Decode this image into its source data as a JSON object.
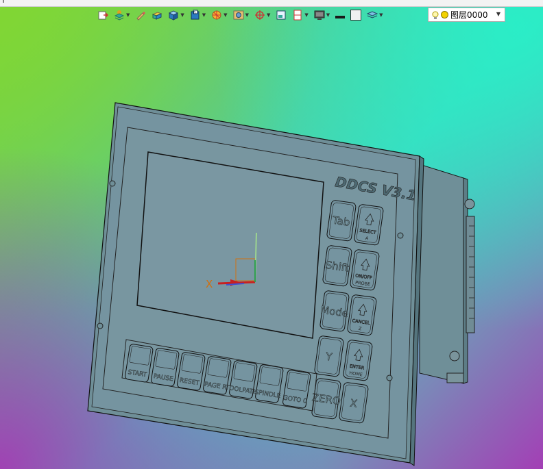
{
  "toolbar": {
    "items": [
      {
        "icon": "exit-icon",
        "dropdown": false
      },
      {
        "icon": "layer-tools-icon",
        "dropdown": true
      },
      {
        "icon": "pencil-icon",
        "dropdown": false
      },
      {
        "icon": "solid-block-icon",
        "dropdown": false
      },
      {
        "icon": "cube-icon",
        "dropdown": true
      },
      {
        "icon": "view-cube-icon",
        "dropdown": true
      },
      {
        "icon": "sphere-segment-icon",
        "dropdown": true
      },
      {
        "icon": "render-mode-icon",
        "dropdown": true
      },
      {
        "icon": "snap-target-icon",
        "dropdown": true
      },
      {
        "icon": "window-icon",
        "dropdown": false
      },
      {
        "icon": "split-view-icon",
        "dropdown": true
      },
      {
        "icon": "display-icon",
        "dropdown": true
      },
      {
        "icon": "line-weight-icon",
        "dropdown": false
      },
      {
        "icon": "color-swatch-icon",
        "dropdown": false
      },
      {
        "icon": "layers-icon",
        "dropdown": true
      }
    ]
  },
  "layer": {
    "name": "图层0000"
  },
  "model": {
    "brand": "DDCS V3.1",
    "side_keys": [
      {
        "top": "Tab"
      },
      {
        "top": "SELECT",
        "sub": "A"
      },
      {
        "top": "Shift"
      },
      {
        "top": "ON/OFF",
        "sub": "PROBE"
      },
      {
        "top": "Mode"
      },
      {
        "top": "CANCEL",
        "sub": "Z"
      },
      {
        "top": "Y"
      },
      {
        "top": "ENTER",
        "sub": "HOME"
      },
      {
        "top": "ZERO"
      },
      {
        "top": "X"
      }
    ],
    "bottom_keys": [
      "START",
      "PAUSE",
      "RESET",
      "PAGE R",
      "TOOLPATH",
      "SPINDLE",
      "GOTO 0"
    ],
    "axis_label": "X"
  }
}
